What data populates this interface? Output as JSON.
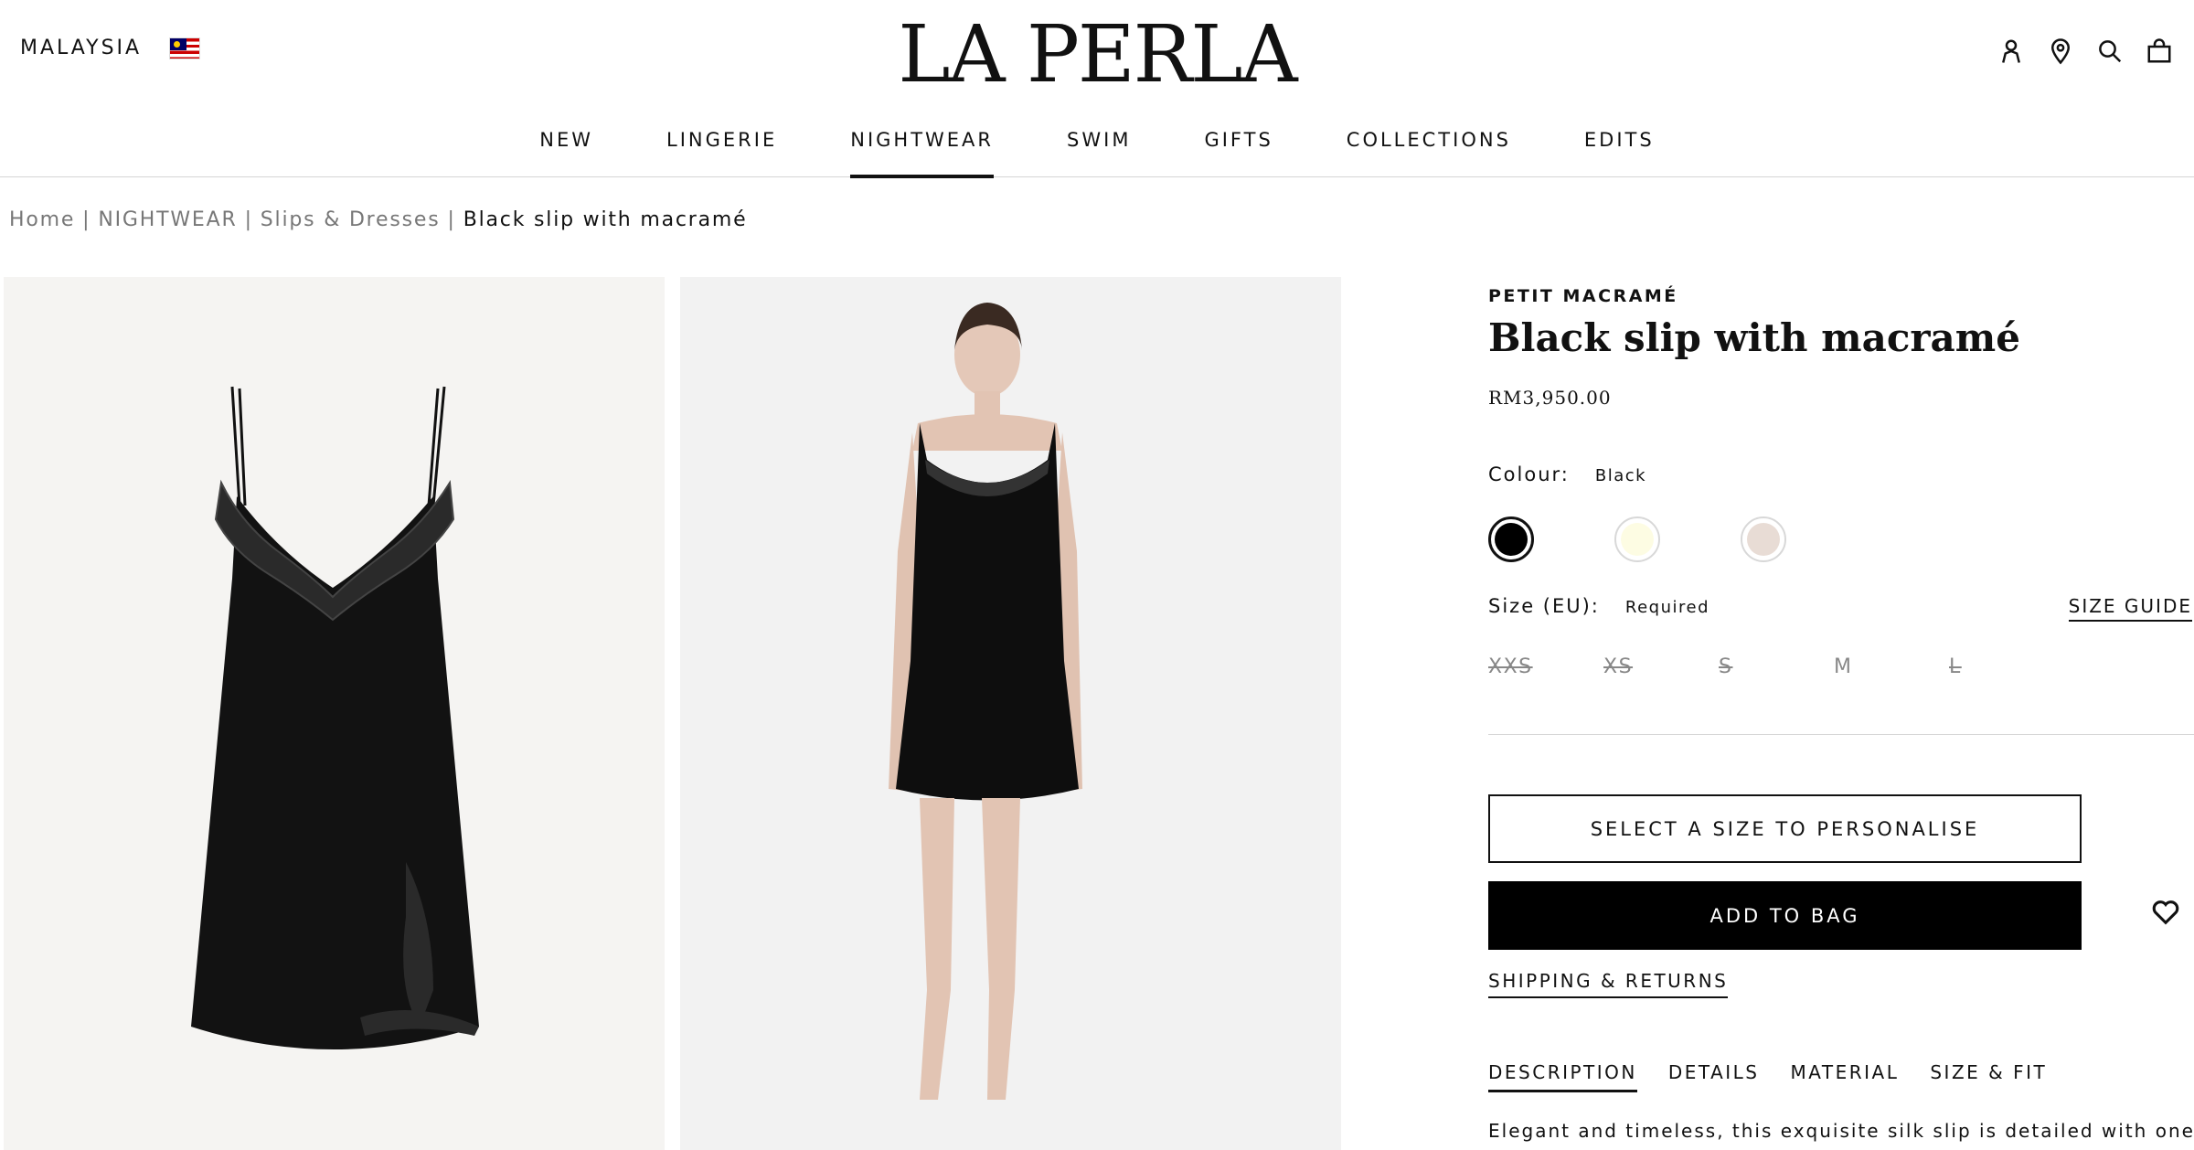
{
  "header": {
    "country": "MALAYSIA",
    "flag_icon": "malaysia-flag-icon",
    "logo": "LA PERLA",
    "icons": [
      "account-icon",
      "store-locator-icon",
      "search-icon",
      "shopping-bag-icon"
    ]
  },
  "nav": {
    "items": [
      {
        "label": "NEW"
      },
      {
        "label": "LINGERIE"
      },
      {
        "label": "NIGHTWEAR",
        "active": true
      },
      {
        "label": "SWIM"
      },
      {
        "label": "GIFTS"
      },
      {
        "label": "COLLECTIONS"
      },
      {
        "label": "EDITS"
      }
    ]
  },
  "breadcrumb": {
    "items": [
      "Home",
      "NIGHTWEAR",
      "Slips & Dresses"
    ],
    "separator": "|",
    "current": "Black slip with macramé"
  },
  "product": {
    "collection": "PETIT MACRAMÉ",
    "title": "Black slip with macramé",
    "price": "RM3,950.00",
    "colour_label": "Colour:",
    "colour_value": "Black",
    "swatches": [
      {
        "name": "Black",
        "hex": "#000000",
        "selected": true
      },
      {
        "name": "Ivory",
        "hex": "#fdfce3",
        "selected": false
      },
      {
        "name": "Nude",
        "hex": "#e8dcd5",
        "selected": false
      }
    ],
    "size_label": "Size (EU):",
    "size_required": "Required",
    "size_guide": "SIZE GUIDE",
    "sizes": [
      {
        "label": "XXS",
        "available": false
      },
      {
        "label": "XS",
        "available": false
      },
      {
        "label": "S",
        "available": false
      },
      {
        "label": "M",
        "available": true
      },
      {
        "label": "L",
        "available": false
      }
    ],
    "personalise_button": "SELECT A SIZE TO PERSONALISE",
    "add_to_bag_button": "ADD TO BAG",
    "wishlist_icon": "heart-icon",
    "shipping_link": "SHIPPING & RETURNS",
    "tabs": [
      {
        "label": "DESCRIPTION",
        "active": true
      },
      {
        "label": "DETAILS"
      },
      {
        "label": "MATERIAL"
      },
      {
        "label": "SIZE & FIT"
      }
    ],
    "description": "Elegant and timeless, this exquisite silk slip is detailed with one of La"
  },
  "colors": {
    "text": "#111111",
    "button_primary": "#000000",
    "muted_text": "#777777",
    "divider": "#d6d6d6"
  }
}
